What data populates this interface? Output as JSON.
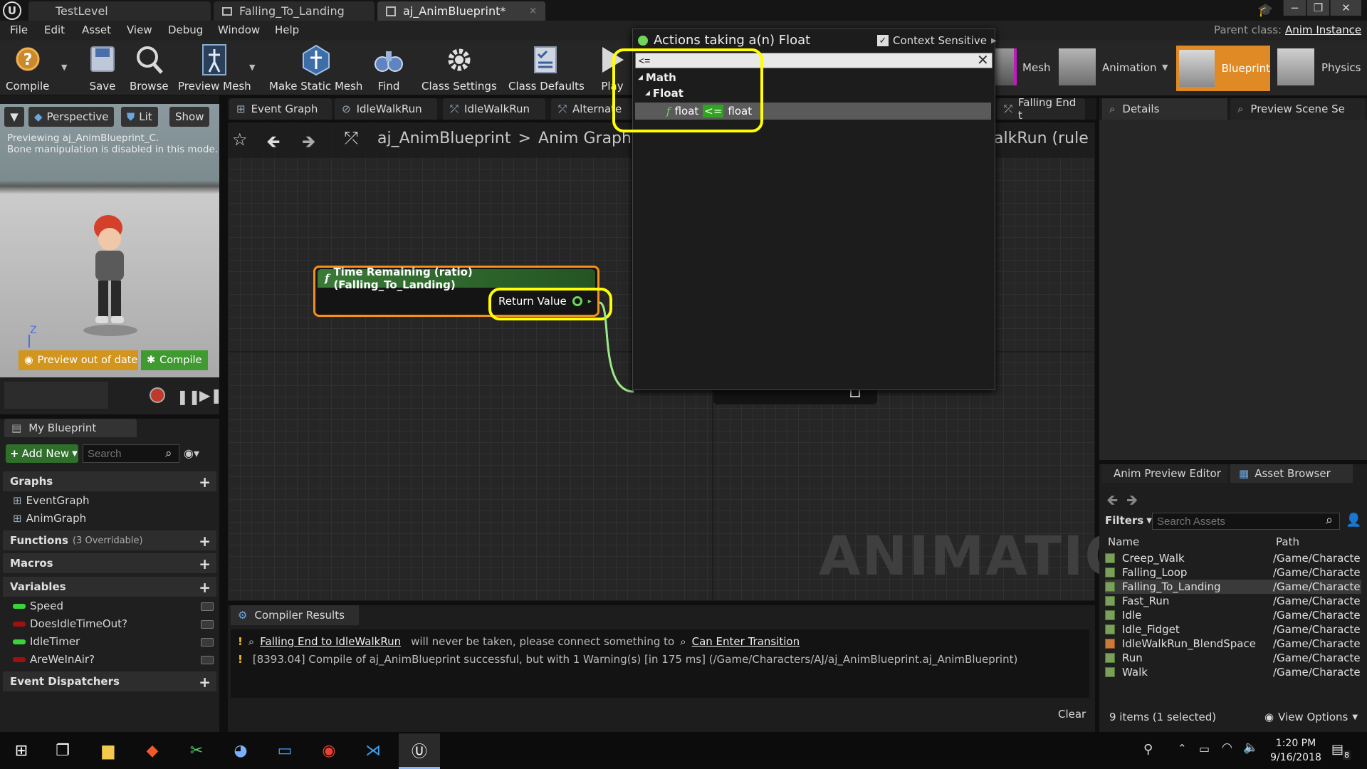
{
  "titlebar": {
    "tabs": [
      {
        "label": "TestLevel"
      },
      {
        "label": "Falling_To_Landing"
      },
      {
        "label": "aj_AnimBlueprint*"
      }
    ],
    "parent_class_label": "Parent class:",
    "parent_class_value": "Anim Instance"
  },
  "menu": [
    "File",
    "Edit",
    "Asset",
    "View",
    "Debug",
    "Window",
    "Help"
  ],
  "toolbar": {
    "compile": "Compile",
    "save": "Save",
    "browse": "Browse",
    "preview_mesh": "Preview Mesh",
    "make_static_mesh": "Make Static Mesh",
    "find": "Find",
    "class_settings": "Class Settings",
    "class_defaults": "Class Defaults",
    "play": "Play"
  },
  "modes": {
    "mesh": "Mesh",
    "animation": "Animation",
    "blueprint": "Blueprint",
    "physics": "Physics"
  },
  "viewport": {
    "perspective": "Perspective",
    "lit": "Lit",
    "show": "Show",
    "line1": "Previewing aj_AnimBlueprint_C.",
    "line2": "Bone manipulation is disabled in this mode.",
    "axis": "Z",
    "preview_out_of_date": "Preview out of date",
    "compile": "Compile"
  },
  "my_blueprint": {
    "tab": "My Blueprint",
    "add_new": "Add New",
    "search_placeholder": "Search",
    "graphs_header": "Graphs",
    "graphs": [
      "EventGraph",
      "AnimGraph"
    ],
    "functions_header": "Functions",
    "functions_note": "(3 Overridable)",
    "macros_header": "Macros",
    "variables_header": "Variables",
    "variables": [
      {
        "name": "Speed",
        "color": "#3ad33a"
      },
      {
        "name": "DoesIdleTimeOut?",
        "color": "#a01010"
      },
      {
        "name": "IdleTimer",
        "color": "#3ad33a"
      },
      {
        "name": "AreWeInAir?",
        "color": "#a01010"
      }
    ],
    "event_dispatchers_header": "Event Dispatchers"
  },
  "graph_tabs": [
    "Event Graph",
    "IdleWalkRun",
    "IdleWalkRun",
    "Alternate",
    "Falling End t"
  ],
  "breadcrumb": {
    "root": "aj_AnimBlueprint",
    "separator": ">",
    "current": "Anim Graph",
    "right_fragment": "alkRun (rule"
  },
  "node": {
    "title": "Time Remaining (ratio) (Falling_To_Landing)",
    "pin": "Return Value"
  },
  "graph_watermark": "ANIMATION",
  "popup": {
    "title": "Actions taking a(n) Float",
    "context_sensitive": "Context Sensitive",
    "search_value": "<=",
    "cat_math": "Math",
    "cat_float": "Float",
    "result_left": "float",
    "result_op": "<=",
    "result_right": "float"
  },
  "details": {
    "tab": "Details",
    "preview_tab": "Preview Scene Se"
  },
  "asset_browser": {
    "tab1": "Anim Preview Editor",
    "tab2": "Asset Browser",
    "filters": "Filters",
    "search_placeholder": "Search Assets",
    "col_name": "Name",
    "col_path": "Path",
    "rows": [
      {
        "name": "Creep_Walk",
        "path": "/Game/Characte"
      },
      {
        "name": "Falling_Loop",
        "path": "/Game/Characte"
      },
      {
        "name": "Falling_To_Landing",
        "path": "/Game/Characte"
      },
      {
        "name": "Fast_Run",
        "path": "/Game/Characte"
      },
      {
        "name": "Idle",
        "path": "/Game/Characte"
      },
      {
        "name": "Idle_Fidget",
        "path": "/Game/Characte"
      },
      {
        "name": "IdleWalkRun_BlendSpace",
        "path": "/Game/Characte"
      },
      {
        "name": "Run",
        "path": "/Game/Characte"
      },
      {
        "name": "Walk",
        "path": "/Game/Characte"
      }
    ],
    "status": "9 items (1 selected)",
    "view_options": "View Options"
  },
  "compiler": {
    "tab": "Compiler Results",
    "msg1_link1": "Falling End to IdleWalkRun",
    "msg1_mid": "will never be taken, please connect something to",
    "msg1_link2": "Can Enter Transition",
    "msg2": "[8393.04] Compile of aj_AnimBlueprint successful, but with 1 Warning(s) [in 175 ms] (/Game/Characters/AJ/aj_AnimBlueprint.aj_AnimBlueprint)",
    "clear": "Clear"
  },
  "taskbar": {
    "time": "1:20 PM",
    "date": "9/16/2018",
    "notif": "8"
  }
}
